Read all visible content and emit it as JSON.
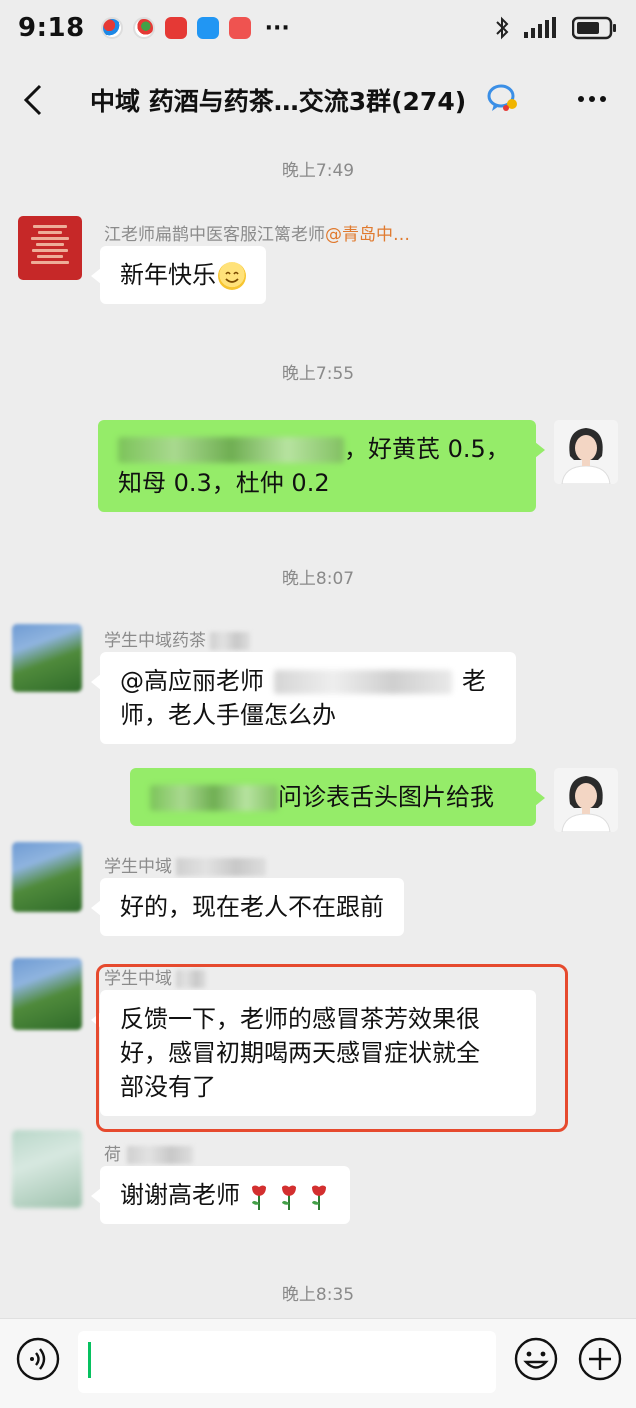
{
  "status_bar": {
    "time": "9:18",
    "more": "···"
  },
  "header": {
    "title": "中域 药酒与药茶…交流3群(274)"
  },
  "messages": {
    "ts1": "晚上7:49",
    "m1_sender": "江老师扁鹊中医客服江篱老师",
    "m1_at": "@青岛中…",
    "m1_text": "新年快乐",
    "ts2": "晚上7:55",
    "m2_line1": "，好黄芪 0.5，",
    "m2_line2": "知母 0.3，杜仲 0.2",
    "ts3": "晚上8:07",
    "m3_sender": "学生中域药茶",
    "m3_line1_a": "@高应丽老师",
    "m3_line1_b": "老",
    "m3_line2": "师，老人手僵怎么办",
    "m4_text": "问诊表舌头图片给我",
    "m5_sender": "学生中域",
    "m5_text": "好的，现在老人不在跟前",
    "m6_sender": "学生中域",
    "m6_line1": "反馈一下，老师的感冒茶芳效果很",
    "m6_line2": "好，感冒初期喝两天感冒症状就全",
    "m6_line3": "部没有了",
    "m7_sender": "荷",
    "m7_text": "谢谢高老师",
    "ts4": "晚上8:35"
  },
  "input": {
    "value": ""
  },
  "colors": {
    "chat_background": "#ededed",
    "outgoing_bubble": "#95ec69",
    "incoming_bubble": "#ffffff",
    "highlight_border": "#e64a2e",
    "mention": "#e07a2f"
  },
  "icons": [
    "back-chevron-icon",
    "group-chat-icon",
    "more-icon",
    "voice-icon",
    "emoji-icon",
    "plus-icon",
    "bluetooth-icon",
    "signal-icon",
    "battery-icon",
    "smile-emoji-icon",
    "rose-emoji-icon"
  ]
}
